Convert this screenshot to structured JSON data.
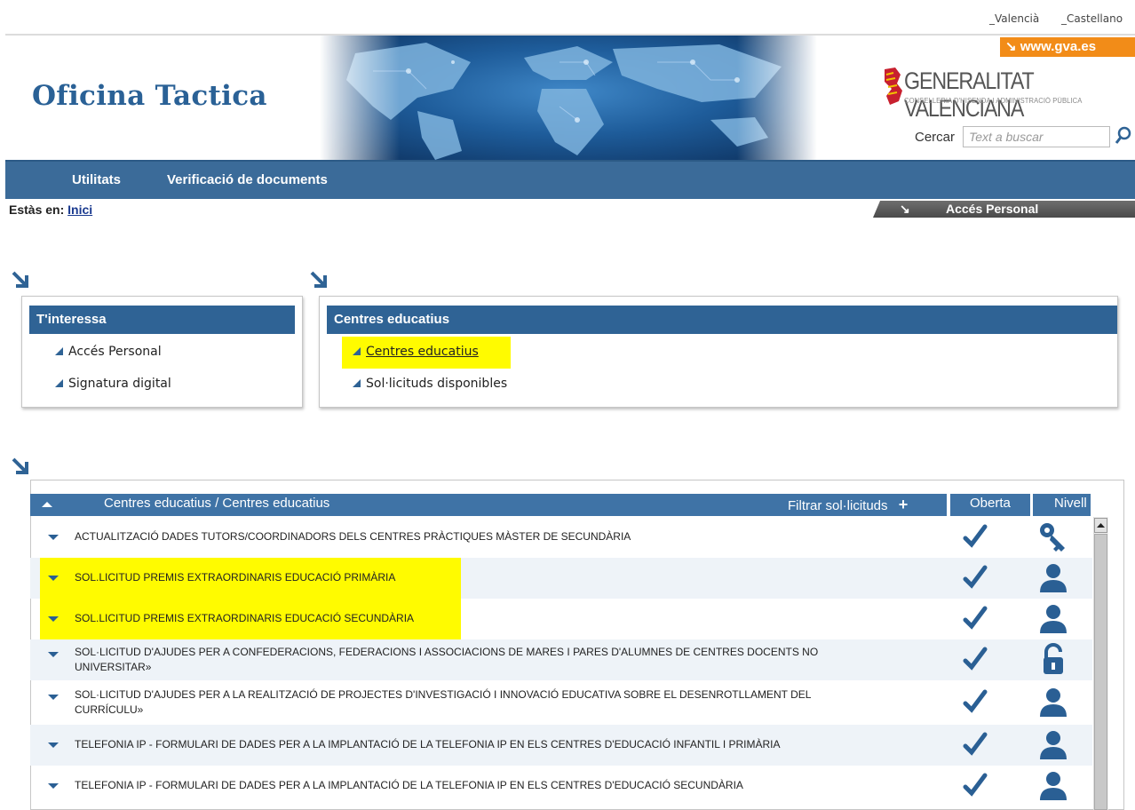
{
  "lang": {
    "valencia": "_Valencià",
    "castellano": "_Castellano"
  },
  "header": {
    "title": "Oficina Tactica",
    "gva_link": "www.gva.es",
    "org_name": "GENERALITAT VALENCIANA",
    "org_sub": "CONSELLERIA D'HISENDA I ADMINISTRACIÓ PÚBLICA",
    "search_label": "Cercar",
    "search_placeholder": "Text a buscar"
  },
  "nav": {
    "items": [
      "Utilitats",
      "Verificació de documents"
    ]
  },
  "breadcrumb": {
    "prefix": "Estàs en:",
    "link": "Inici"
  },
  "acces_tab": "Accés Personal",
  "box_interessa": {
    "title": "T'interessa",
    "links": [
      "Accés Personal",
      "Signatura digital"
    ]
  },
  "box_centres": {
    "title": "Centres educatius",
    "links": [
      "Centres educatius",
      "Sol·licituds disponibles"
    ]
  },
  "table": {
    "title": "Centres educatius / Centres educatius",
    "filter_label": "Filtrar sol·licituds",
    "col_oberta": "Oberta",
    "col_nivell": "Nivell",
    "rows": [
      {
        "l1": "ACTUALITZACIÓ DADES TUTORS/COORDINADORS DELS CENTRES PRÀCTIQUES MÀSTER DE SECUNDÀRIA",
        "l2": "",
        "level_icon": "key-icon",
        "highlight": false
      },
      {
        "l1": "SOL.LICITUD PREMIS EXTRAORDINARIS EDUCACIÓ PRIMÀRIA",
        "l2": "",
        "level_icon": "user-icon",
        "highlight": true
      },
      {
        "l1": "SOL.LICITUD PREMIS EXTRAORDINARIS EDUCACIÓ SECUNDÀRIA",
        "l2": "",
        "level_icon": "user-icon",
        "highlight": true
      },
      {
        "l1": "SOL·LICITUD D'AJUDES PER A CONFEDERACIONS, FEDERACIONS I ASSOCIACIONS DE MARES I PARES D'ALUMNES DE CENTRES DOCENTS NO",
        "l2": "UNIVERSITAR»",
        "level_icon": "unlock-icon",
        "highlight": false
      },
      {
        "l1": "SOL·LICITUD D'AJUDES PER A LA REALITZACIÓ DE PROJECTES D'INVESTIGACIÓ I INNOVACIÓ EDUCATIVA SOBRE EL DESENROTLLAMENT DEL",
        "l2": "CURRÍCULU»",
        "level_icon": "user-icon",
        "highlight": false
      },
      {
        "l1": "TELEFONIA IP - FORMULARI DE DADES PER A LA IMPLANTACIÓ DE LA TELEFONIA IP EN ELS CENTRES D'EDUCACIÓ INFANTIL I PRIMÀRIA",
        "l2": "",
        "level_icon": "user-icon",
        "highlight": false
      },
      {
        "l1": "TELEFONIA IP - FORMULARI DE DADES PER A LA IMPLANTACIÓ DE LA TELEFONIA IP EN ELS CENTRES D'EDUCACIÓ SECUNDÀRIA",
        "l2": "",
        "level_icon": "user-icon",
        "highlight": false
      }
    ]
  },
  "colors": {
    "brand_blue": "#2f6395",
    "nav_blue": "#3b6b99",
    "orange": "#f28c18",
    "highlight": "#fffb00",
    "check": "#2a5f94"
  }
}
